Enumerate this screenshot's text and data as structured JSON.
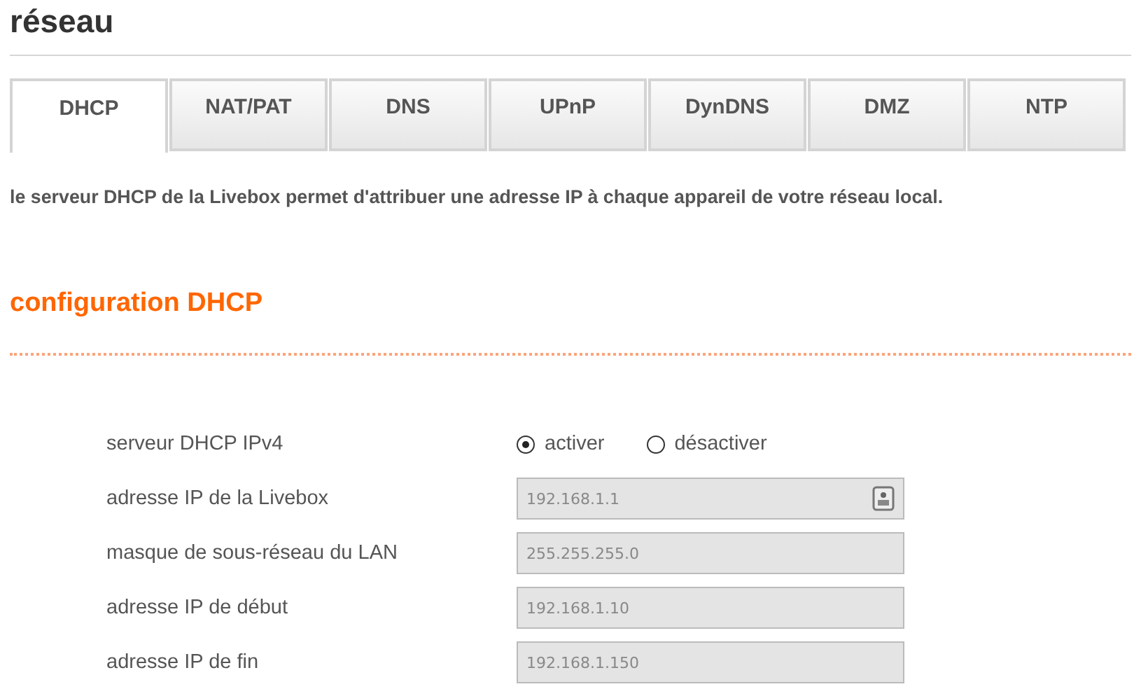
{
  "page_title": "réseau",
  "tabs": [
    {
      "label": "DHCP",
      "selected": true
    },
    {
      "label": "NAT/PAT",
      "selected": false
    },
    {
      "label": "DNS",
      "selected": false
    },
    {
      "label": "UPnP",
      "selected": false
    },
    {
      "label": "DynDNS",
      "selected": false
    },
    {
      "label": "DMZ",
      "selected": false
    },
    {
      "label": "NTP",
      "selected": false
    }
  ],
  "description": "le serveur DHCP de la Livebox permet d'attribuer une adresse IP à chaque appareil de votre réseau local.",
  "section_title": "configuration DHCP",
  "rows": [
    {
      "kind": "radio",
      "label": "serveur DHCP IPv4",
      "options": [
        {
          "label": "activer",
          "selected": true
        },
        {
          "label": "désactiver",
          "selected": false
        }
      ]
    },
    {
      "kind": "input",
      "label": "adresse IP de la Livebox",
      "value": "192.168.1.1",
      "has_icon": true
    },
    {
      "kind": "input",
      "label": "masque de sous-réseau du LAN",
      "value": "255.255.255.0",
      "has_icon": false
    },
    {
      "kind": "input",
      "label": "adresse IP de début",
      "value": "192.168.1.10",
      "has_icon": false
    },
    {
      "kind": "input",
      "label": "adresse IP de fin",
      "value": "192.168.1.150",
      "has_icon": false
    }
  ]
}
